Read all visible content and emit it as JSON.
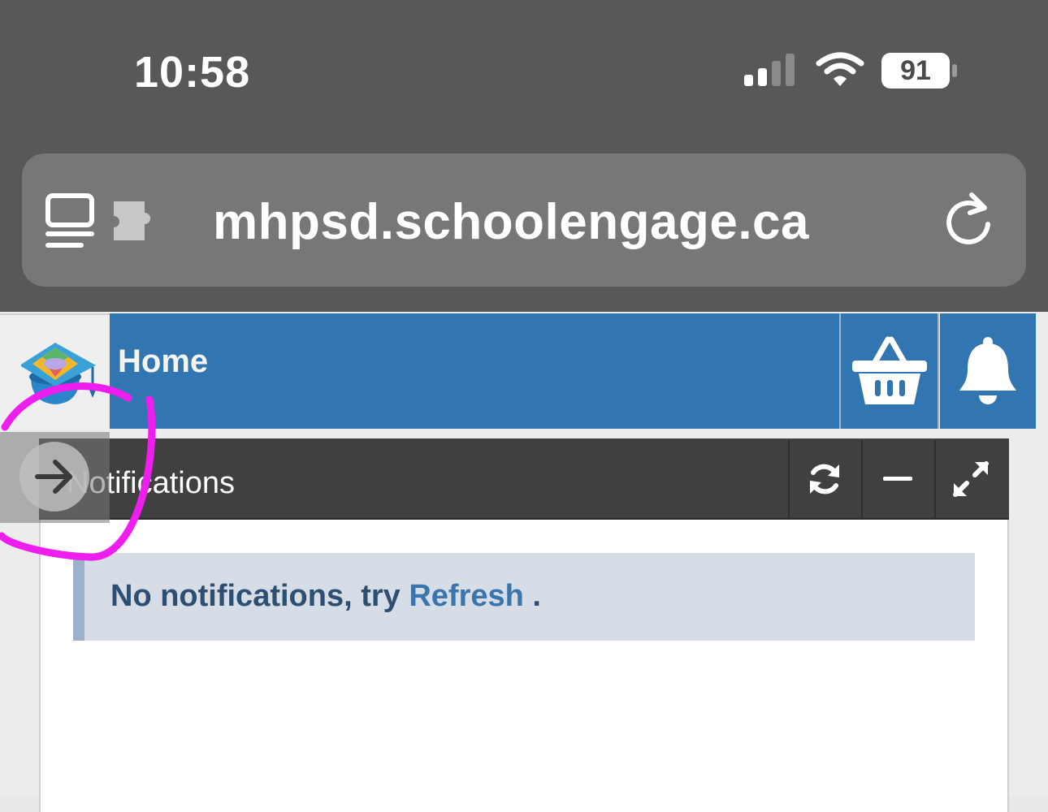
{
  "status_bar": {
    "time": "10:58",
    "battery": "91"
  },
  "browser": {
    "url": "mhpsd.schoolengage.ca"
  },
  "app": {
    "page_title": "Home",
    "colors": {
      "primary": "#3276b1",
      "widget_header": "#404040",
      "alert_bg": "#d6dde6",
      "alert_text": "#2e4e72"
    }
  },
  "widget": {
    "title": "Notifications",
    "alert": {
      "message": "No notifications, try",
      "link": "Refresh",
      "suffix": "."
    }
  }
}
